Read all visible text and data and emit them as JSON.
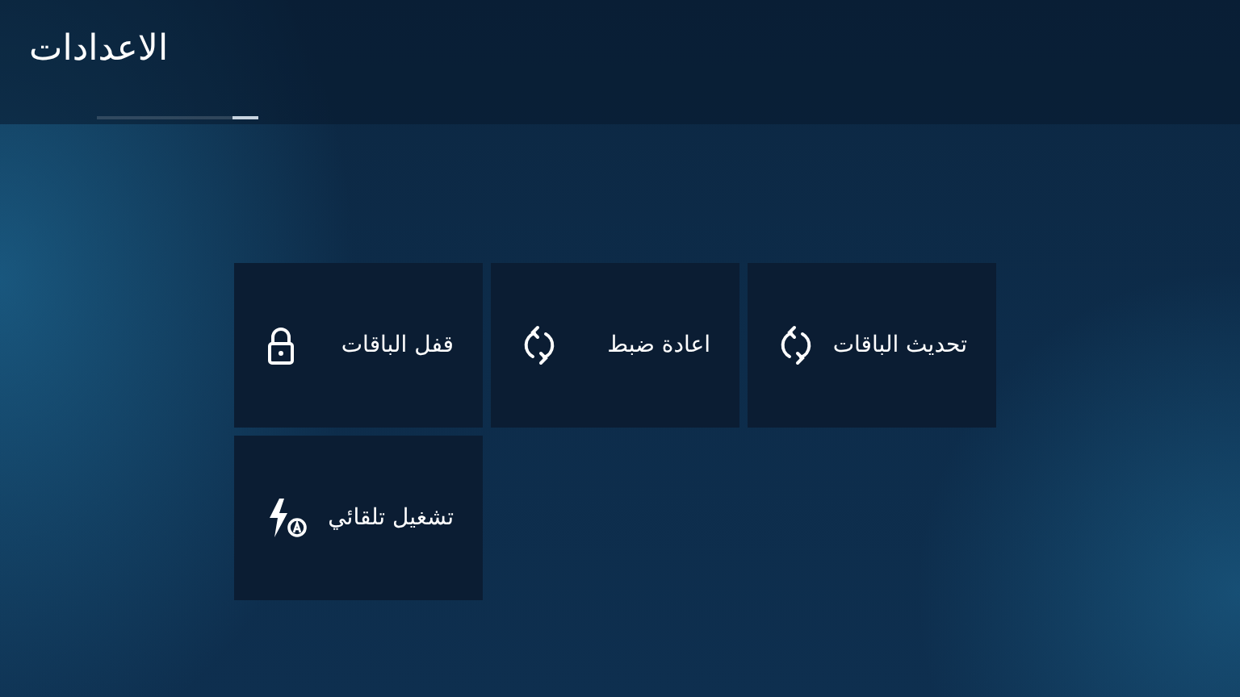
{
  "header": {
    "title": "الاعدادات"
  },
  "tiles": [
    {
      "label": "تحديث الباقات",
      "kind": "refresh"
    },
    {
      "label": "اعادة ضبط",
      "kind": "refresh"
    },
    {
      "label": "قفل الباقات",
      "kind": "lock"
    },
    {
      "label": "تشغيل تلقائي",
      "kind": "auto"
    }
  ]
}
